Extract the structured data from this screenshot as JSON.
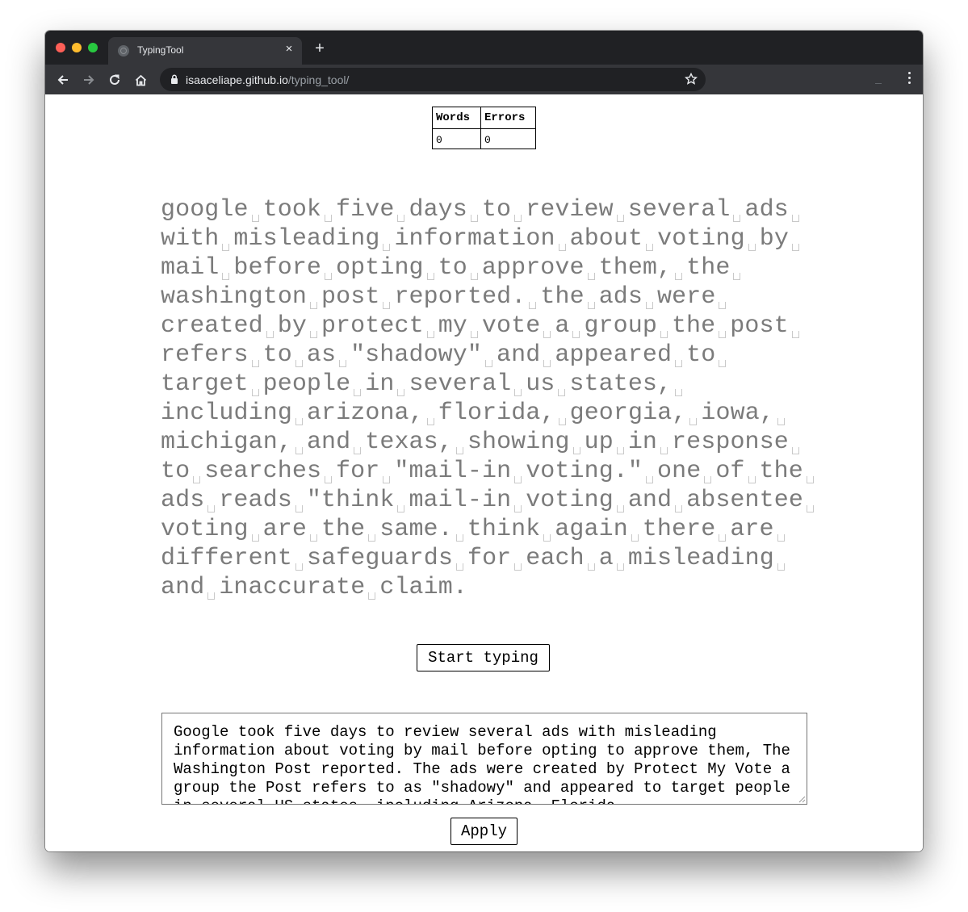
{
  "browser": {
    "tab_title": "TypingTool",
    "tab_close": "×",
    "new_tab": "+",
    "url_host": "isaaceliape.github.io",
    "url_path": "/typing_tool/"
  },
  "stats": {
    "headers": [
      "Words",
      "Errors"
    ],
    "values": [
      "0",
      "0"
    ]
  },
  "passage": {
    "lines": [
      "google took five days to review several ads",
      "with misleading information about voting by",
      "mail before opting to approve them, the",
      "washington post reported. the ads were",
      "created by protect my vote a group the post",
      "refers to as \"shadowy\" and appeared to",
      "target people in several us states,",
      "including arizona, florida, georgia, iowa,",
      "michigan, and texas, showing up in response",
      "to searches for \"mail-in voting.\" one of the",
      "ads reads \"think mail-in voting and absentee",
      "voting are the same. think again there are",
      "different safeguards for each a misleading",
      "and inaccurate claim."
    ],
    "trailing_space_lines": [
      0,
      1,
      2,
      3,
      4,
      5,
      6,
      7,
      8,
      9,
      10,
      11,
      12
    ]
  },
  "start_button": "Start typing",
  "source_text": "Google took five days to review several ads with misleading information about voting by mail before opting to approve them, The Washington Post reported. The ads were created by Protect My Vote a group the Post refers to as \"shadowy\" and appeared to target people in several US states, including Arizona, Florida,",
  "apply_button": "Apply",
  "colors": {
    "passage_text": "#7b7b7b",
    "space_marker": "#c9c9c9",
    "chrome_dark": "#202124",
    "chrome_tab": "#35363a"
  }
}
